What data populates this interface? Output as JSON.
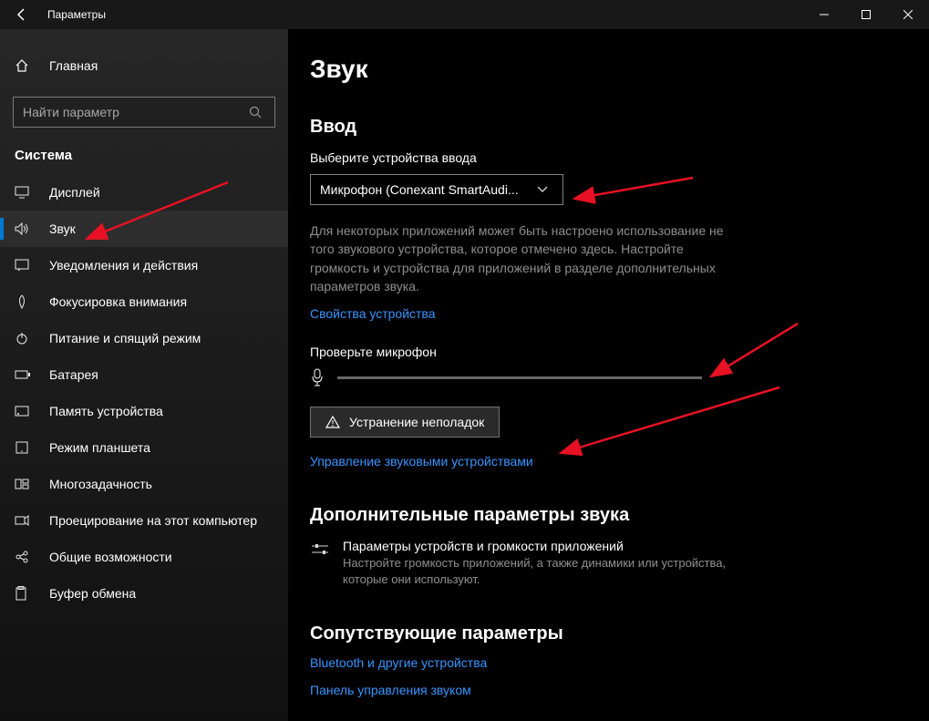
{
  "titlebar": {
    "title": "Параметры"
  },
  "sidebar": {
    "home": "Главная",
    "search_placeholder": "Найти параметр",
    "section": "Система",
    "items": [
      {
        "label": "Дисплей"
      },
      {
        "label": "Звук"
      },
      {
        "label": "Уведомления и действия"
      },
      {
        "label": "Фокусировка внимания"
      },
      {
        "label": "Питание и спящий режим"
      },
      {
        "label": "Батарея"
      },
      {
        "label": "Память устройства"
      },
      {
        "label": "Режим планшета"
      },
      {
        "label": "Многозадачность"
      },
      {
        "label": "Проецирование на этот компьютер"
      },
      {
        "label": "Общие возможности"
      },
      {
        "label": "Буфер обмена"
      }
    ]
  },
  "main": {
    "page_title": "Звук",
    "input_section": "Ввод",
    "choose_input_label": "Выберите устройства ввода",
    "input_device": "Микрофон (Conexant SmartAudi...",
    "input_help": "Для некоторых приложений может быть настроено использование не того звукового устройства, которое отмечено здесь. Настройте громкость и устройства для приложений в разделе дополнительных параметров звука.",
    "device_props": "Свойства устройства",
    "test_mic": "Проверьте микрофон",
    "troubleshoot": "Устранение неполадок",
    "manage_devices": "Управление звуковыми устройствами",
    "advanced_title": "Дополнительные параметры звука",
    "advanced_item_title": "Параметры устройств и громкости приложений",
    "advanced_item_desc": "Настройте громкость приложений, а также динамики или устройства, которые они используют.",
    "related_title": "Сопутствующие параметры",
    "related_bt": "Bluetooth и другие устройства",
    "related_panel": "Панель управления звуком"
  }
}
